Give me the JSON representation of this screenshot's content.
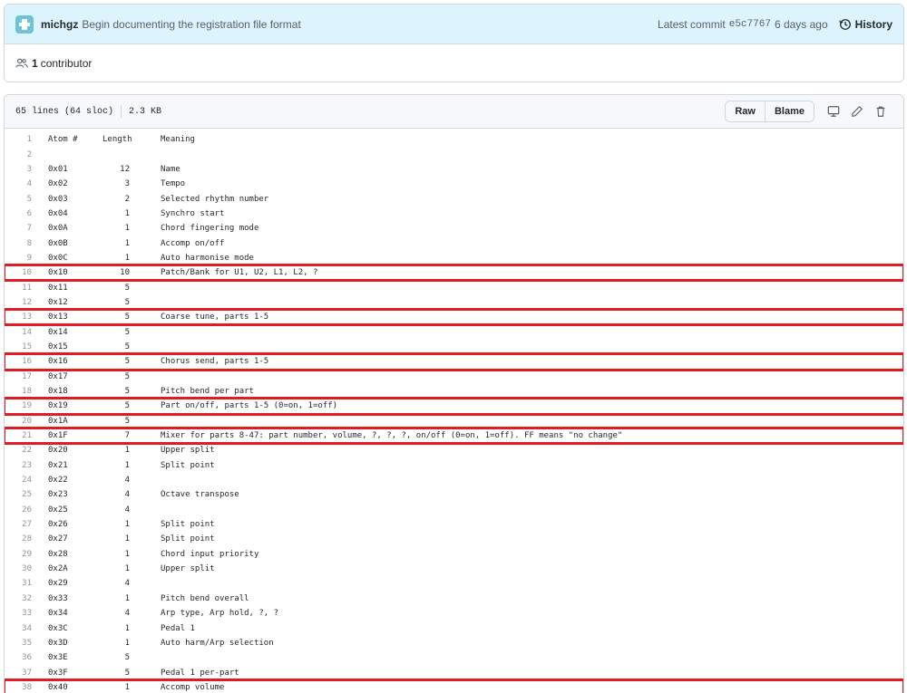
{
  "commit": {
    "author": "michgz",
    "message": "Begin documenting the registration file format",
    "latest_label": "Latest commit",
    "sha": "e5c7767",
    "age": "6 days ago",
    "history_label": "History"
  },
  "contributors": {
    "count": "1",
    "label": "contributor"
  },
  "file": {
    "lines_info": "65 lines (64 sloc)",
    "size": "2.3 KB",
    "raw_label": "Raw",
    "blame_label": "Blame"
  },
  "colors": {
    "highlight": "#e01b24",
    "commit_bg": "#ddf4ff"
  },
  "code_lines": [
    {
      "n": "1",
      "atom": "Atom #",
      "len": "Length",
      "mean": "Meaning",
      "hl": false,
      "header": true
    },
    {
      "n": "2",
      "atom": "",
      "len": "",
      "mean": "",
      "hl": false
    },
    {
      "n": "3",
      "atom": "0x01",
      "len": "12",
      "mean": "Name",
      "hl": false
    },
    {
      "n": "4",
      "atom": "0x02",
      "len": "3",
      "mean": "Tempo",
      "hl": false
    },
    {
      "n": "5",
      "atom": "0x03",
      "len": "2",
      "mean": "Selected rhythm number",
      "hl": false
    },
    {
      "n": "6",
      "atom": "0x04",
      "len": "1",
      "mean": "Synchro start",
      "hl": false
    },
    {
      "n": "7",
      "atom": "0x0A",
      "len": "1",
      "mean": "Chord fingering mode",
      "hl": false
    },
    {
      "n": "8",
      "atom": "0x0B",
      "len": "1",
      "mean": "Accomp on/off",
      "hl": false
    },
    {
      "n": "9",
      "atom": "0x0C",
      "len": "1",
      "mean": "Auto harmonise mode",
      "hl": false
    },
    {
      "n": "10",
      "atom": "0x10",
      "len": "10",
      "mean": "Patch/Bank for U1, U2, L1, L2, ?",
      "hl": true
    },
    {
      "n": "11",
      "atom": "0x11",
      "len": "5",
      "mean": "",
      "hl": false
    },
    {
      "n": "12",
      "atom": "0x12",
      "len": "5",
      "mean": "",
      "hl": false
    },
    {
      "n": "13",
      "atom": "0x13",
      "len": "5",
      "mean": "Coarse tune, parts 1-5",
      "hl": true
    },
    {
      "n": "14",
      "atom": "0x14",
      "len": "5",
      "mean": "",
      "hl": false
    },
    {
      "n": "15",
      "atom": "0x15",
      "len": "5",
      "mean": "",
      "hl": false
    },
    {
      "n": "16",
      "atom": "0x16",
      "len": "5",
      "mean": "Chorus send, parts 1-5",
      "hl": true
    },
    {
      "n": "17",
      "atom": "0x17",
      "len": "5",
      "mean": "",
      "hl": false
    },
    {
      "n": "18",
      "atom": "0x18",
      "len": "5",
      "mean": "Pitch bend per part",
      "hl": false
    },
    {
      "n": "19",
      "atom": "0x19",
      "len": "5",
      "mean": "Part on/off, parts 1-5 (0=on, 1=off)",
      "hl": true
    },
    {
      "n": "20",
      "atom": "0x1A",
      "len": "5",
      "mean": "",
      "hl": false
    },
    {
      "n": "21",
      "atom": "0x1F",
      "len": "7",
      "mean": "Mixer for parts 8-47: part number, volume, ?, ?, ?, on/off (0=on, 1=off). FF means \"no change\"",
      "hl": true
    },
    {
      "n": "22",
      "atom": "0x20",
      "len": "1",
      "mean": "Upper split",
      "hl": false
    },
    {
      "n": "23",
      "atom": "0x21",
      "len": "1",
      "mean": "Split point",
      "hl": false
    },
    {
      "n": "24",
      "atom": "0x22",
      "len": "4",
      "mean": "",
      "hl": false
    },
    {
      "n": "25",
      "atom": "0x23",
      "len": "4",
      "mean": "Octave transpose",
      "hl": false
    },
    {
      "n": "26",
      "atom": "0x25",
      "len": "4",
      "mean": "",
      "hl": false
    },
    {
      "n": "27",
      "atom": "0x26",
      "len": "1",
      "mean": "Split point",
      "hl": false
    },
    {
      "n": "28",
      "atom": "0x27",
      "len": "1",
      "mean": "Split point",
      "hl": false
    },
    {
      "n": "29",
      "atom": "0x28",
      "len": "1",
      "mean": "Chord input priority",
      "hl": false
    },
    {
      "n": "30",
      "atom": "0x2A",
      "len": "1",
      "mean": "Upper split",
      "hl": false
    },
    {
      "n": "31",
      "atom": "0x29",
      "len": "4",
      "mean": "",
      "hl": false
    },
    {
      "n": "32",
      "atom": "0x33",
      "len": "1",
      "mean": "Pitch bend overall",
      "hl": false
    },
    {
      "n": "33",
      "atom": "0x34",
      "len": "4",
      "mean": "Arp type, Arp hold, ?, ?",
      "hl": false
    },
    {
      "n": "34",
      "atom": "0x3C",
      "len": "1",
      "mean": "Pedal 1",
      "hl": false
    },
    {
      "n": "35",
      "atom": "0x3D",
      "len": "1",
      "mean": "Auto harm/Arp selection",
      "hl": false
    },
    {
      "n": "36",
      "atom": "0x3E",
      "len": "5",
      "mean": "",
      "hl": false
    },
    {
      "n": "37",
      "atom": "0x3F",
      "len": "5",
      "mean": "Pedal 1 per-part",
      "hl": false
    },
    {
      "n": "38",
      "atom": "0x40",
      "len": "1",
      "mean": "Accomp volume",
      "hl": true
    }
  ]
}
